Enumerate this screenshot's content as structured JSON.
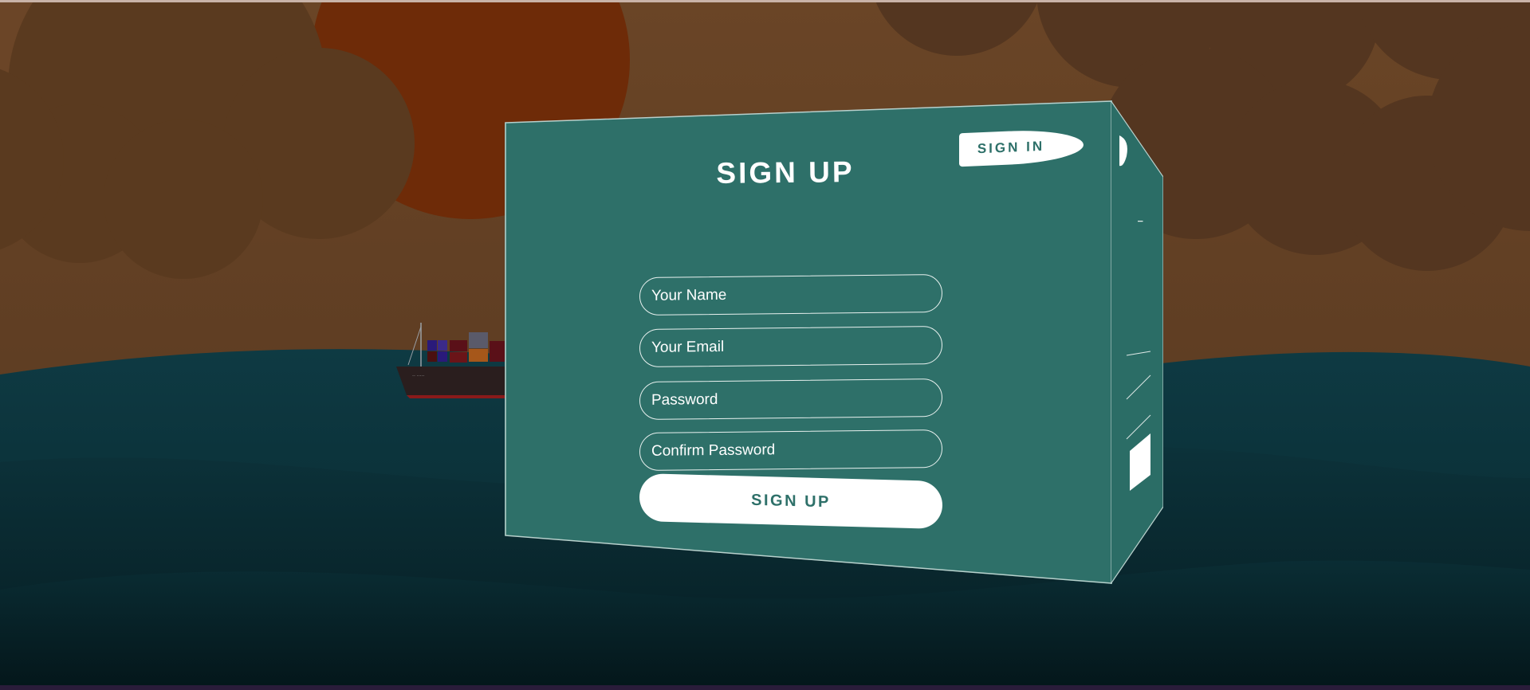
{
  "form": {
    "title": "SIGN UP",
    "switch_button": "SIGN IN",
    "fields": [
      {
        "placeholder": "Your Name",
        "type": "text"
      },
      {
        "placeholder": "Your Email",
        "type": "email"
      },
      {
        "placeholder": "Password",
        "type": "password"
      },
      {
        "placeholder": "Confirm Password",
        "type": "password"
      }
    ],
    "submit_label": "SIGN UP"
  },
  "colors": {
    "card": "#2e7069",
    "sky": "#5c3b22",
    "sun": "#6e2b08",
    "sea": "#0b3038",
    "accent_text": "#2e7069"
  }
}
